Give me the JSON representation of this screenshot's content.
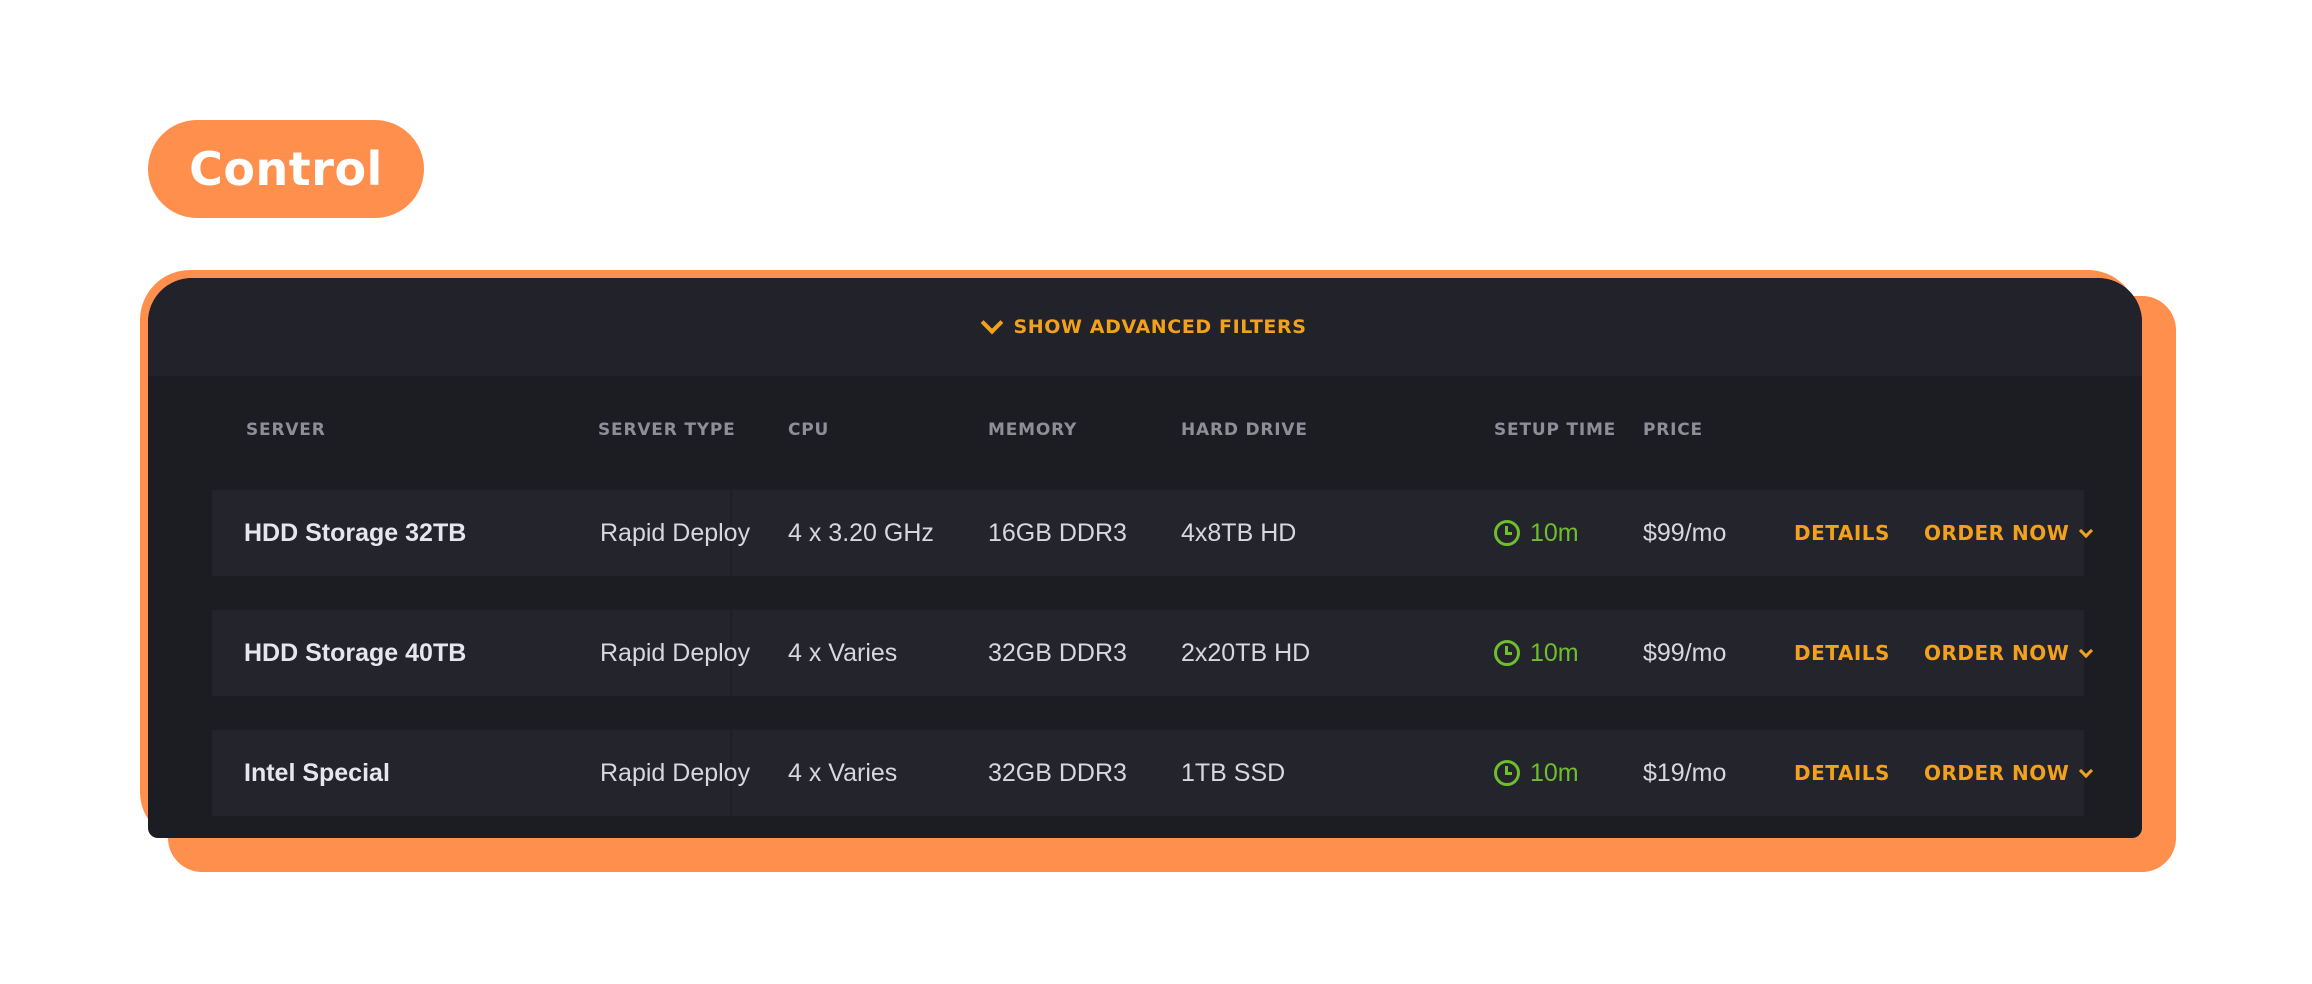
{
  "header": {
    "badge_label": "Control"
  },
  "filters": {
    "toggle_label": "SHOW ADVANCED FILTERS",
    "toggle_icon": "chevron-down-icon"
  },
  "table": {
    "columns": [
      "SERVER",
      "SERVER TYPE",
      "CPU",
      "MEMORY",
      "HARD DRIVE",
      "SETUP TIME",
      "PRICE"
    ],
    "rows": [
      {
        "server": "HDD Storage 32TB",
        "type": "Rapid Deploy",
        "cpu": "4 x 3.20 GHz",
        "memory": "16GB DDR3",
        "drive": "4x8TB HD",
        "setup": "10m",
        "price": "$99/mo",
        "details": "DETAILS",
        "order": "ORDER NOW"
      },
      {
        "server": "HDD Storage 40TB",
        "type": "Rapid Deploy",
        "cpu": "4 x Varies",
        "memory": "32GB DDR3",
        "drive": "2x20TB HD",
        "setup": "10m",
        "price": "$99/mo",
        "details": "DETAILS",
        "order": "ORDER NOW"
      },
      {
        "server": "Intel Special",
        "type": "Rapid Deploy",
        "cpu": "4 x Varies",
        "memory": "32GB DDR3",
        "drive": "1TB SSD",
        "setup": "10m",
        "price": "$19/mo",
        "details": "DETAILS",
        "order": "ORDER NOW"
      }
    ]
  },
  "colors": {
    "accent": "#ff8f4c",
    "panel": "#1c1c23",
    "row": "#24242d",
    "link": "#f2a11d",
    "setup_time": "#6fbe2b"
  }
}
